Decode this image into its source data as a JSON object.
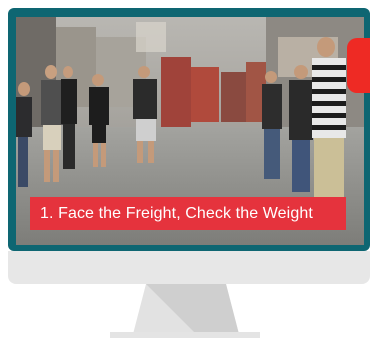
{
  "video": {
    "caption": "1. Face the Freight, Check the Weight"
  },
  "colors": {
    "frame": "#0e6672",
    "caption_background": "#e5333d",
    "side_tab": "#ee2a24",
    "chin": "#e7e7e7",
    "stand_light": "#e2e2e2",
    "stand_shadow": "#cfcfcf"
  },
  "icons": {
    "monitor": "desktop-monitor-icon"
  }
}
